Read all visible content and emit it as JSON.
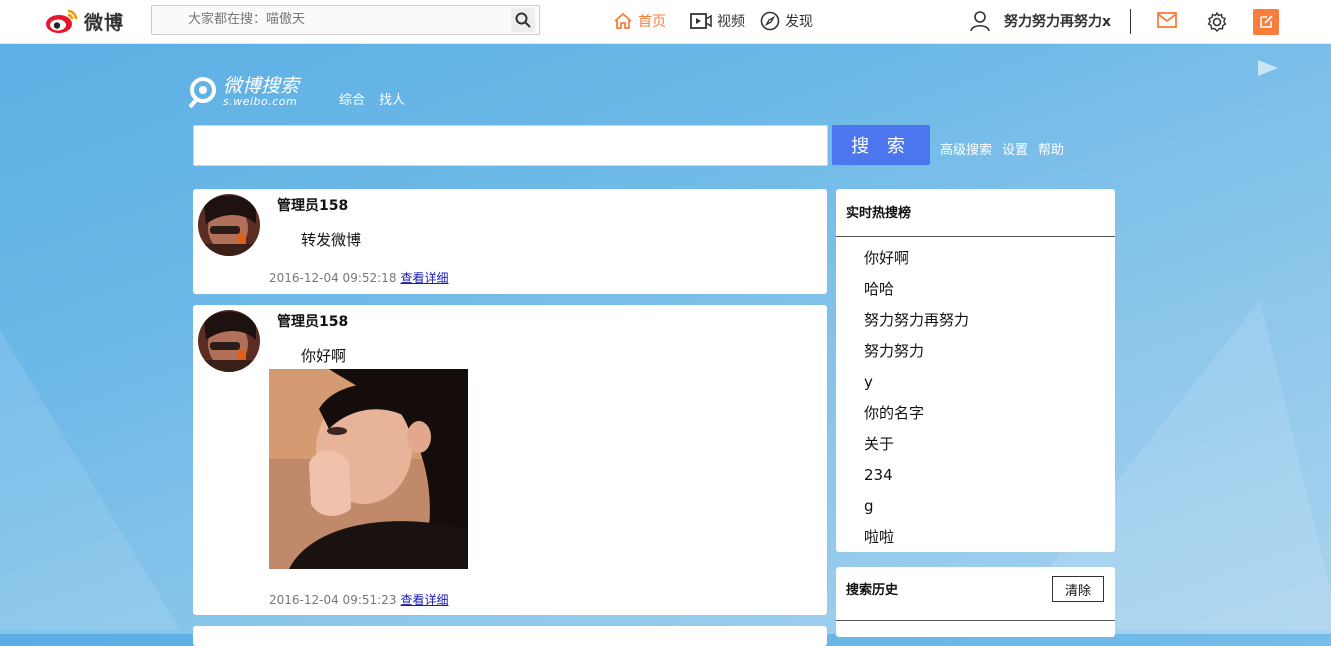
{
  "topbar": {
    "logo_text": "微博",
    "search_placeholder": "大家都在搜：喵傲天",
    "nav_home": "首页",
    "nav_video": "视频",
    "nav_discover": "发现",
    "username": "努力努力再努力x",
    "accent_color": "#fa7d3c"
  },
  "search": {
    "logo_title": "微博搜索",
    "logo_subtitle": "s.weibo.com",
    "tabs": [
      "综合",
      "找人"
    ],
    "button_label": "搜 索",
    "links": [
      "高级搜索",
      "设置",
      "帮助"
    ],
    "button_color": "#4b76ee"
  },
  "feed": [
    {
      "user": "管理员158",
      "text": "转发微博",
      "time": "2016-12-04 09:52:18",
      "detail_link": "查看详细"
    },
    {
      "user": "管理员158",
      "text": "你好啊",
      "time": "2016-12-04 09:51:23",
      "detail_link": "查看详细"
    }
  ],
  "hot": {
    "title": "实时热搜榜",
    "items": [
      "你好啊",
      "哈哈",
      "努力努力再努力",
      "努力努力",
      "y",
      "你的名字",
      "关于",
      "234",
      "g",
      "啦啦"
    ]
  },
  "history": {
    "title": "搜索历史",
    "clear_label": "清除"
  }
}
